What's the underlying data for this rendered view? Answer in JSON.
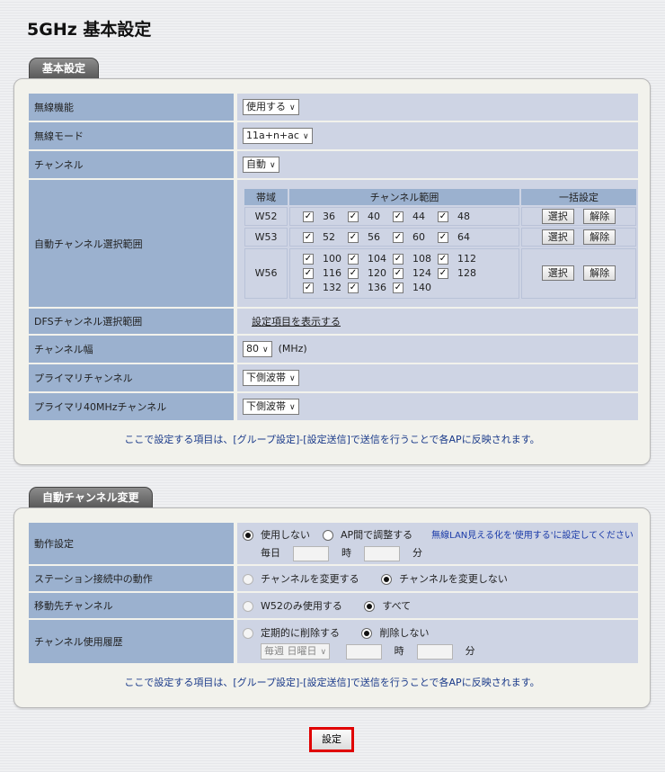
{
  "page_title": "5GHz 基本設定",
  "basic": {
    "tab": "基本設定",
    "wireless_func": {
      "label": "無線機能",
      "value": "使用する"
    },
    "wireless_mode": {
      "label": "無線モード",
      "value": "11a+n+ac"
    },
    "channel": {
      "label": "チャンネル",
      "value": "自動"
    },
    "auto_range": {
      "label": "自動チャンネル選択範囲",
      "header_band": "帯域",
      "header_range": "チャンネル範囲",
      "header_bulk": "一括設定",
      "select_label": "選択",
      "release_label": "解除",
      "check_mark": "✓",
      "bands": [
        {
          "name": "W52",
          "channels": [
            "36",
            "40",
            "44",
            "48"
          ]
        },
        {
          "name": "W53",
          "channels": [
            "52",
            "56",
            "60",
            "64"
          ]
        },
        {
          "name": "W56",
          "channels": [
            "100",
            "104",
            "108",
            "112",
            "116",
            "120",
            "124",
            "128",
            "132",
            "136",
            "140"
          ]
        }
      ]
    },
    "dfs": {
      "label": "DFSチャンネル選択範囲",
      "link": "設定項目を表示する"
    },
    "width": {
      "label": "チャンネル幅",
      "value": "80",
      "unit": "(MHz)"
    },
    "primary": {
      "label": "プライマリチャンネル",
      "value": "下側波帯"
    },
    "primary40": {
      "label": "プライマリ40MHzチャンネル",
      "value": "下側波帯"
    },
    "note": "ここで設定する項目は、[グループ設定]-[設定送信]で送信を行うことで各APに反映されます。"
  },
  "auto_change": {
    "tab": "自動チャンネル変更",
    "operation": {
      "label": "動作設定",
      "opt_off": "使用しない",
      "opt_ap": "AP間で調整する",
      "hint": "無線LAN見える化を'使用する'に設定してください",
      "daily": "毎日",
      "hour": "時",
      "minute": "分"
    },
    "station": {
      "label": "ステーション接続中の動作",
      "opt_change": "チャンネルを変更する",
      "opt_nochange": "チャンネルを変更しない"
    },
    "dest": {
      "label": "移動先チャンネル",
      "opt_w52": "W52のみ使用する",
      "opt_all": "すべて"
    },
    "history": {
      "label": "チャンネル使用履歴",
      "opt_periodic": "定期的に削除する",
      "opt_none": "削除しない",
      "weekly": "毎週 日曜日",
      "hour": "時",
      "minute": "分"
    },
    "note": "ここで設定する項目は、[グループ設定]-[設定送信]で送信を行うことで各APに反映されます。"
  },
  "submit_label": "設定",
  "chevron": "∨"
}
